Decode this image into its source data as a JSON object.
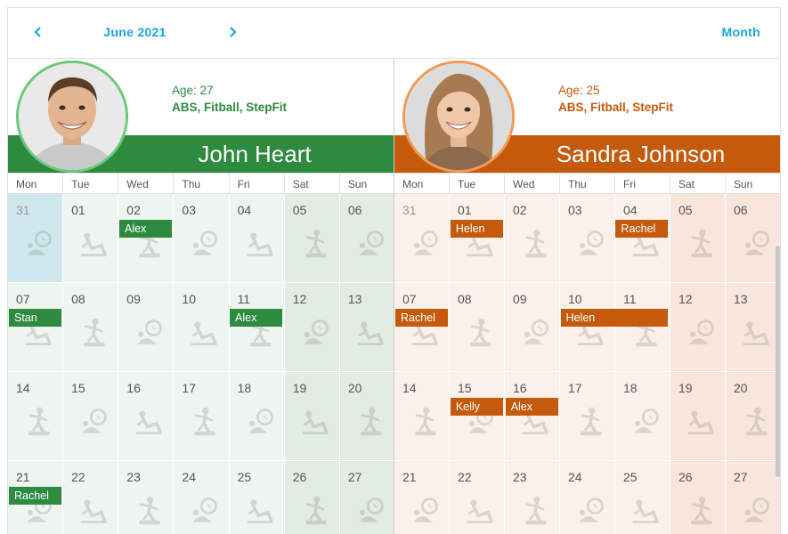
{
  "toolbar": {
    "period": "June 2021",
    "view": "Month",
    "prev_icon": "chevron-left-icon",
    "next_icon": "chevron-right-icon"
  },
  "weekdays": [
    "Mon",
    "Tue",
    "Wed",
    "Thu",
    "Fri",
    "Sat",
    "Sun"
  ],
  "resources": [
    {
      "name": "John Heart",
      "age": "Age: 27",
      "skills": "ABS, Fitball, StepFit",
      "color": "#2d8a3e",
      "avatar_icon": "john-heart-photo",
      "events": [
        {
          "text": "Alex",
          "week": 0,
          "day": 2,
          "span": 1
        },
        {
          "text": "Stan",
          "week": 1,
          "day": 0,
          "span": 1
        },
        {
          "text": "Alex",
          "week": 1,
          "day": 4,
          "span": 1
        },
        {
          "text": "Rachel",
          "week": 3,
          "day": 0,
          "span": 1
        }
      ]
    },
    {
      "name": "Sandra Johnson",
      "age": "Age: 25",
      "skills": "ABS, Fitball, StepFit",
      "color": "#c55a0c",
      "avatar_icon": "sandra-johnson-photo",
      "events": [
        {
          "text": "Helen",
          "week": 0,
          "day": 1,
          "span": 1
        },
        {
          "text": "Rachel",
          "week": 0,
          "day": 4,
          "span": 1
        },
        {
          "text": "Rachel",
          "week": 1,
          "day": 0,
          "span": 1
        },
        {
          "text": "Helen",
          "week": 1,
          "day": 3,
          "span": 2
        },
        {
          "text": "Kelly",
          "week": 2,
          "day": 1,
          "span": 1
        },
        {
          "text": "Alex",
          "week": 2,
          "day": 2,
          "span": 1
        }
      ]
    }
  ],
  "weeks": [
    [
      "31",
      "01",
      "02",
      "03",
      "04",
      "05",
      "06"
    ],
    [
      "07",
      "08",
      "09",
      "10",
      "11",
      "12",
      "13"
    ],
    [
      "14",
      "15",
      "16",
      "17",
      "18",
      "19",
      "20"
    ],
    [
      "21",
      "22",
      "23",
      "24",
      "25",
      "26",
      "27"
    ]
  ],
  "other_month_cells": [
    "0-0"
  ],
  "icon_names": [
    "fitball-icon",
    "abs-icon",
    "stepfit-icon"
  ]
}
